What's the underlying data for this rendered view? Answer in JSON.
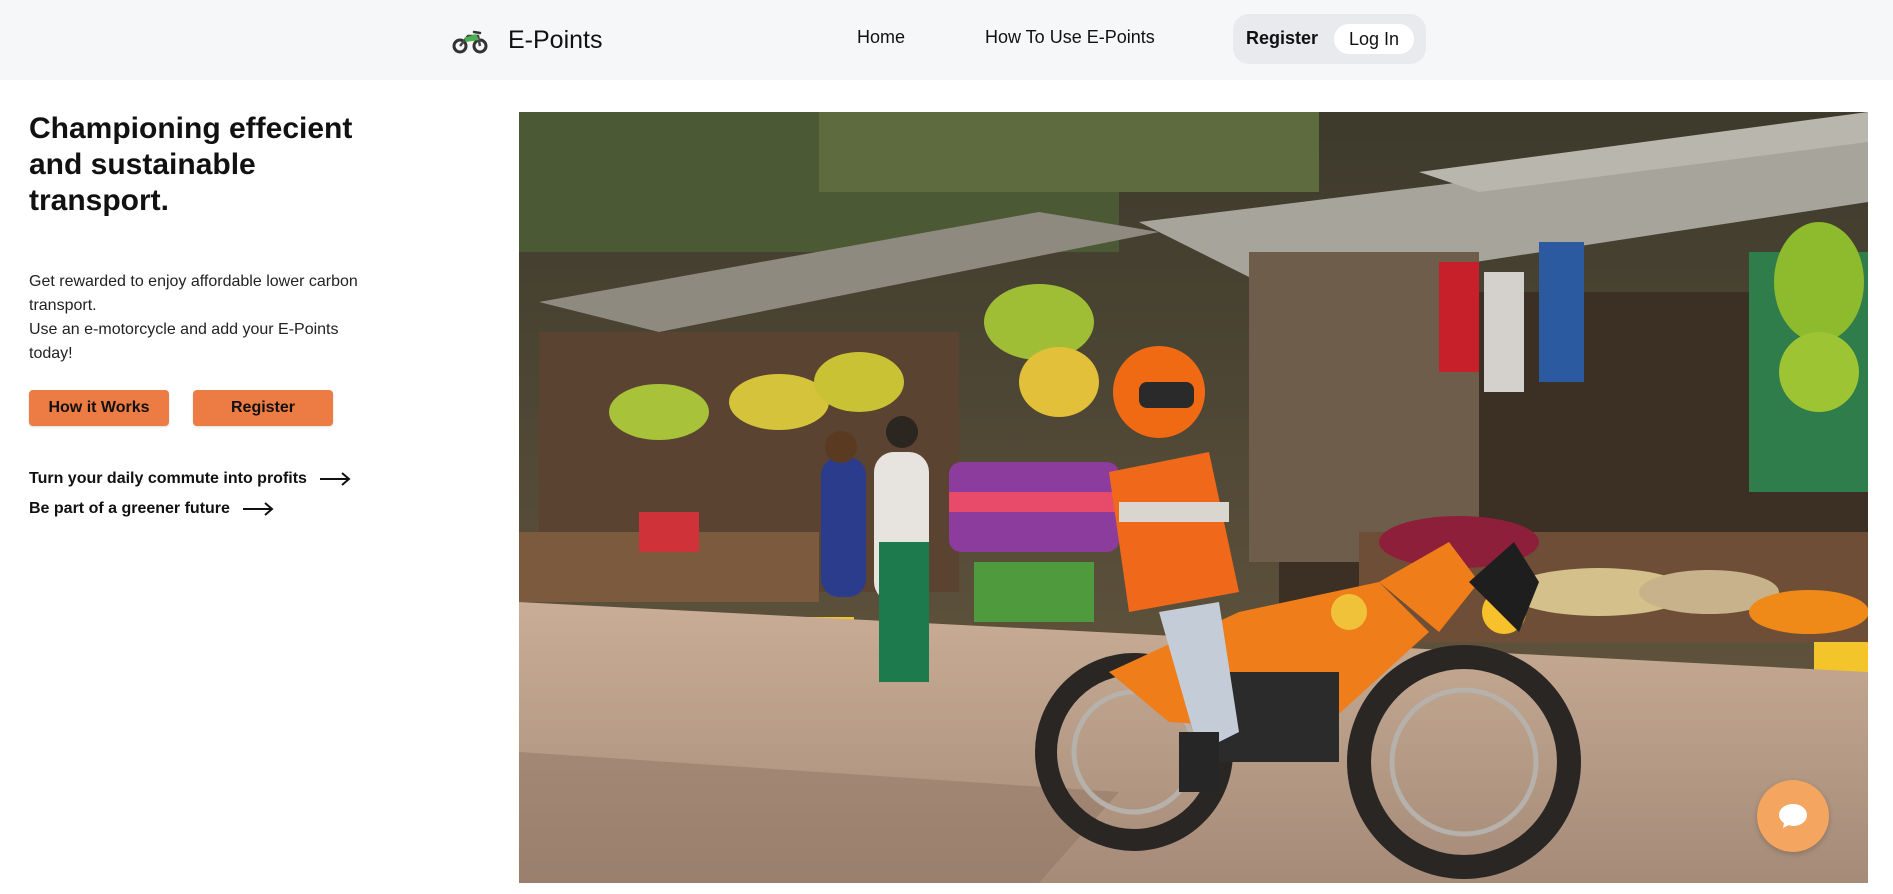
{
  "header": {
    "brand": {
      "name": "E-Points",
      "icon": "motorcycle-icon"
    },
    "nav": {
      "home": "Home",
      "how_to": "How To Use E-Points"
    },
    "auth": {
      "register": "Register",
      "login": "Log In"
    }
  },
  "hero": {
    "title": "Championing effecient and sustainable transport.",
    "text_line1": "Get rewarded to enjoy affordable lower carbon transport.",
    "text_line2": "Use an e-motorcycle and add your E-Points today!",
    "buttons": {
      "how_it_works": "How it Works",
      "register": "Register"
    },
    "links": [
      {
        "label": "Turn your daily commute into profits",
        "icon": "arrow-right-icon"
      },
      {
        "label": "Be part of a greener future",
        "icon": "arrow-right-icon"
      }
    ],
    "image": {
      "subject": "rider on orange e-motorcycle passing a fruit market"
    }
  },
  "chat": {
    "icon": "chat-bubble-icon"
  },
  "colors": {
    "accent": "#ed7b44",
    "chat": "#f4a55f",
    "header_bg": "#f6f7f9",
    "auth_bg": "#e8eaed"
  }
}
